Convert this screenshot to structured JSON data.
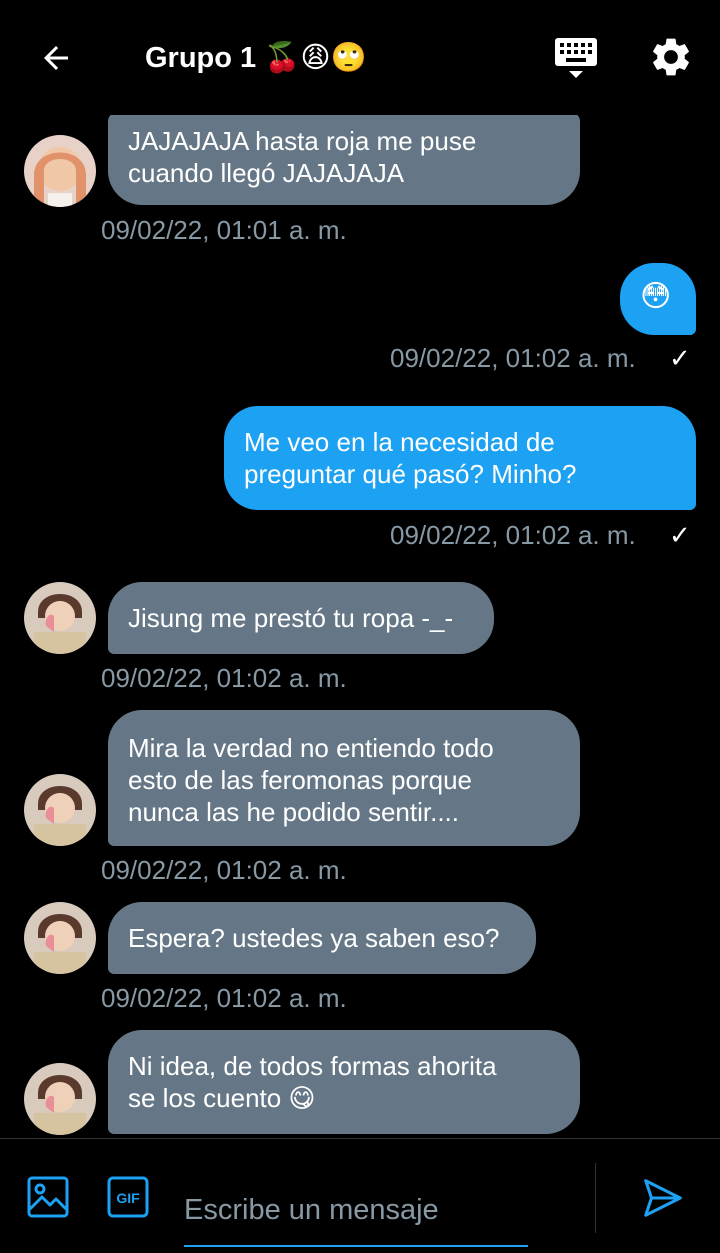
{
  "header": {
    "title": "Grupo 1",
    "title_emojis": [
      "🍒",
      "😩",
      "🙄"
    ],
    "icons": {
      "back": "arrow-left-icon",
      "keyboard": "keyboard-icon",
      "settings": "gear-icon"
    }
  },
  "messages": [
    {
      "direction": "in",
      "sender_avatar": "avatar-user-a",
      "lines": [
        "JAJAJAJA hasta roja me puse",
        "cuando llegó JAJAJAJA"
      ],
      "timestamp": "09/02/22, 01:01 a. m."
    },
    {
      "direction": "out",
      "lines": [
        "😳"
      ],
      "timestamp": "09/02/22, 01:02 a. m.",
      "status": "✓"
    },
    {
      "direction": "out",
      "lines": [
        "Me veo en la necesidad de",
        "preguntar qué pasó? Minho?"
      ],
      "timestamp": "09/02/22, 01:02 a. m.",
      "status": "✓"
    },
    {
      "direction": "in",
      "sender_avatar": "avatar-user-b",
      "lines": [
        "Jisung me prestó tu ropa -_-"
      ],
      "timestamp": "09/02/22, 01:02 a. m."
    },
    {
      "direction": "in",
      "sender_avatar": "avatar-user-b",
      "lines": [
        "Mira la verdad no entiendo todo",
        "esto de las feromonas porque",
        "nunca las he podido sentir...."
      ],
      "timestamp": "09/02/22, 01:02 a. m."
    },
    {
      "direction": "in",
      "sender_avatar": "avatar-user-b",
      "lines": [
        "Espera? ustedes ya saben eso?"
      ],
      "timestamp": "09/02/22, 01:02 a. m."
    },
    {
      "direction": "in",
      "sender_avatar": "avatar-user-b",
      "lines": [
        "Ni idea, de todos formas ahorita",
        "se los cuento 😋"
      ]
    }
  ],
  "composer": {
    "placeholder": "Escribe un mensaje",
    "value": "",
    "gif_label": "GIF",
    "icons": {
      "image": "image-icon",
      "gif": "gif-icon",
      "send": "send-icon"
    }
  },
  "colors": {
    "incoming_bubble": "#657786",
    "outgoing_bubble": "#1da1f2",
    "timestamp": "#8899a6",
    "accent": "#1da1f2",
    "background": "#000000"
  }
}
